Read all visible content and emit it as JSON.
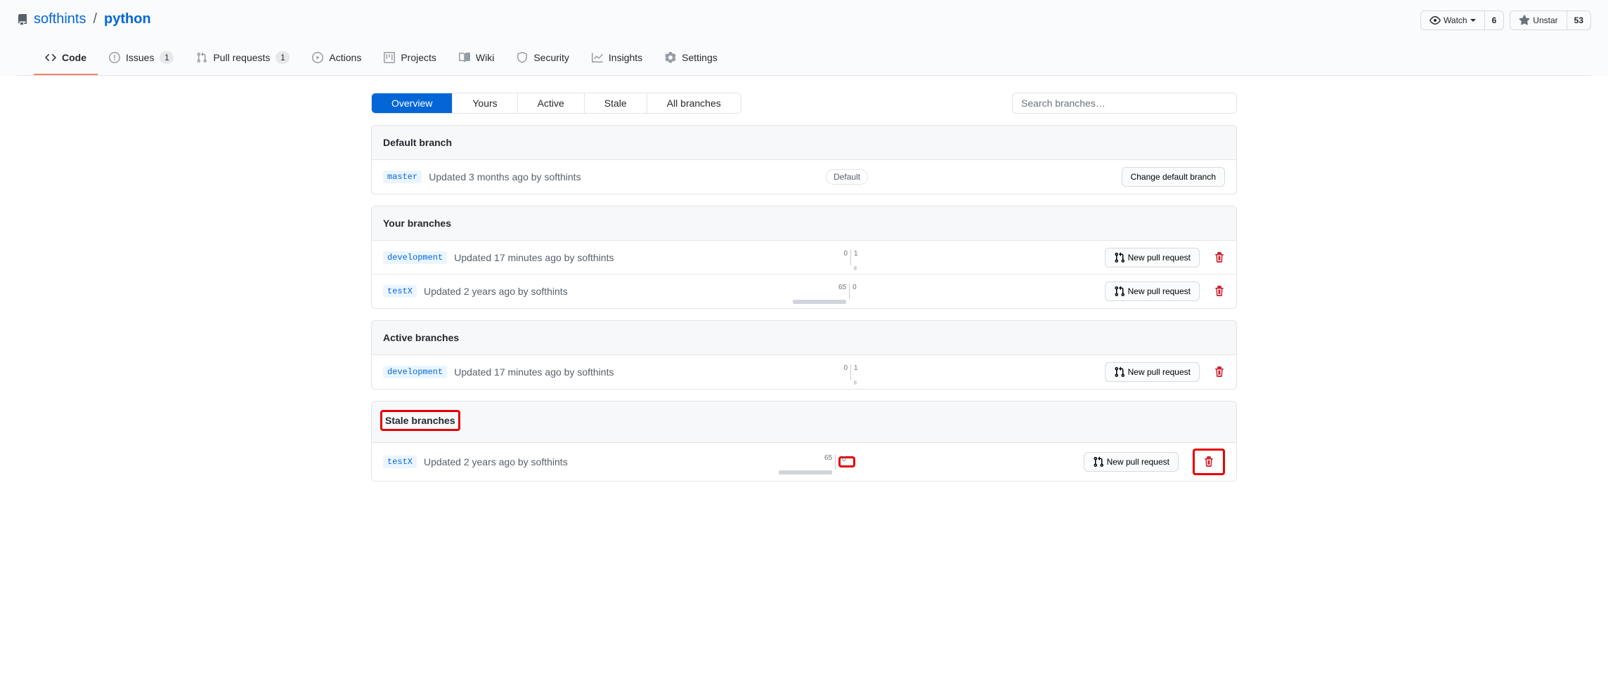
{
  "repo": {
    "owner": "softhints",
    "name": "python"
  },
  "repoActions": {
    "watch": "Watch",
    "watch_count": "6",
    "unstar": "Unstar",
    "star_count": "53"
  },
  "nav": {
    "code": "Code",
    "issues": "Issues",
    "issues_count": "1",
    "pulls": "Pull requests",
    "pulls_count": "1",
    "actions": "Actions",
    "projects": "Projects",
    "wiki": "Wiki",
    "security": "Security",
    "insights": "Insights",
    "settings": "Settings"
  },
  "subnav": {
    "overview": "Overview",
    "yours": "Yours",
    "active": "Active",
    "stale": "Stale",
    "all": "All branches"
  },
  "search": {
    "placeholder": "Search branches…"
  },
  "sections": {
    "default_header": "Default branch",
    "default_branch": {
      "name": "master",
      "update": "Updated 3 months ago by softhints",
      "label": "Default",
      "change_btn": "Change default branch"
    },
    "your_header": "Your branches",
    "your_branches": [
      {
        "name": "development",
        "update": "Updated 17 minutes ago by softhints",
        "behind": "0",
        "ahead": "1",
        "behind_w": 0,
        "ahead_w": 4
      },
      {
        "name": "testX",
        "update": "Updated 2 years ago by softhints",
        "behind": "65",
        "ahead": "0",
        "behind_w": 76,
        "ahead_w": 0
      }
    ],
    "active_header": "Active branches",
    "active_branches": [
      {
        "name": "development",
        "update": "Updated 17 minutes ago by softhints",
        "behind": "0",
        "ahead": "1",
        "behind_w": 0,
        "ahead_w": 4
      }
    ],
    "stale_header": "Stale branches",
    "stale_branches": [
      {
        "name": "testX",
        "update": "Updated 2 years ago by softhints",
        "behind": "65",
        "ahead": "0",
        "behind_w": 76,
        "ahead_w": 0
      }
    ]
  },
  "labels": {
    "new_pr": "New pull request"
  }
}
